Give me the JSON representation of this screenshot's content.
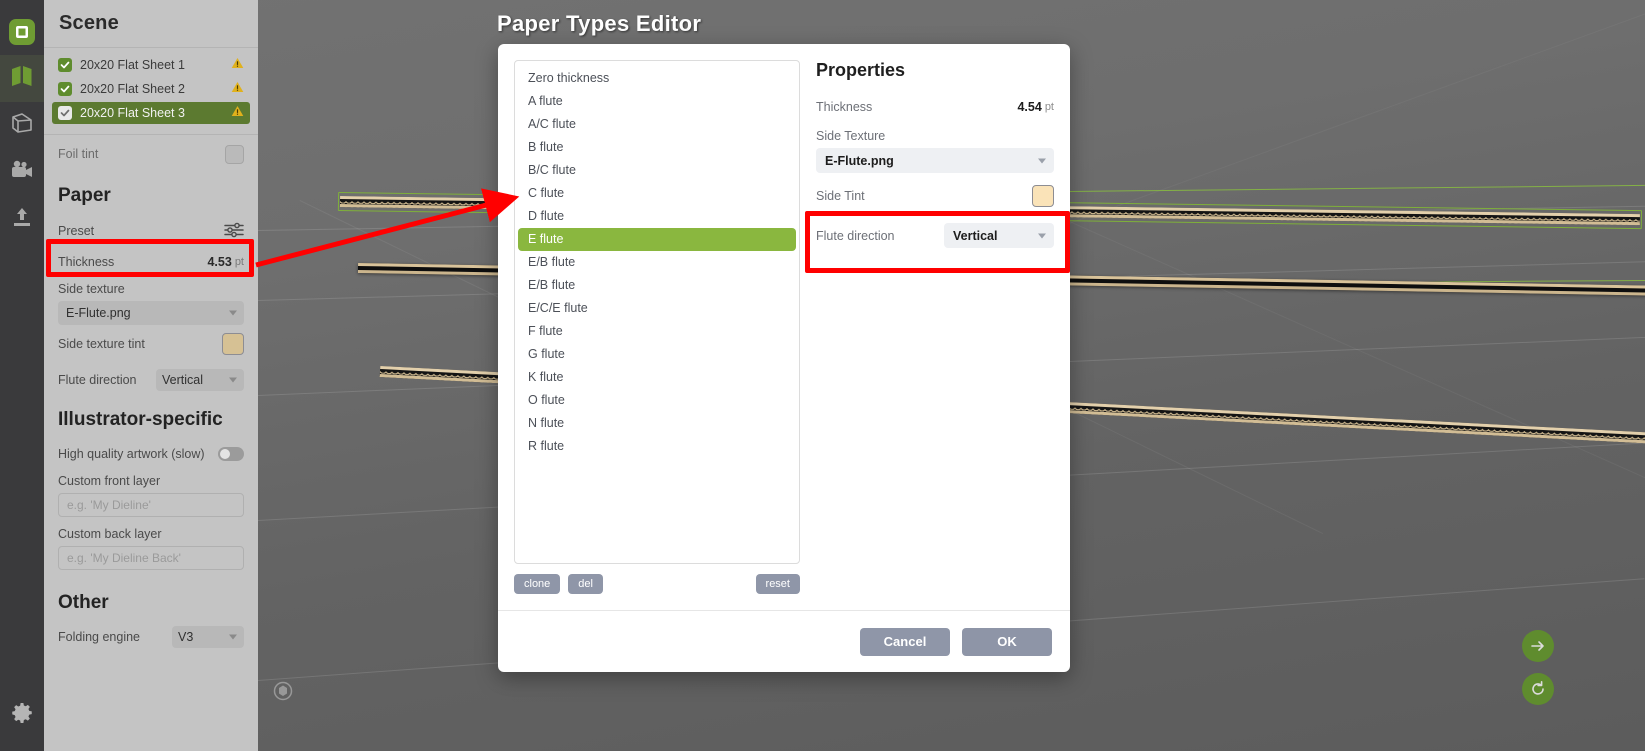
{
  "window": {
    "modal_title": "Paper Types Editor"
  },
  "rail": {
    "items": [
      {
        "name": "logo-icon",
        "label": "Logo"
      },
      {
        "name": "dieline-icon",
        "label": "Dieline"
      },
      {
        "name": "box-3d-icon",
        "label": "3D Box"
      },
      {
        "name": "camera-icon",
        "label": "Camera"
      },
      {
        "name": "export-icon",
        "label": "Export"
      }
    ],
    "gear": {
      "name": "gear-icon",
      "label": "Settings"
    }
  },
  "sidebar": {
    "title": "Scene",
    "scene_items": [
      {
        "label": "20x20 Flat Sheet 1",
        "checked": true,
        "warning": true,
        "selected": false
      },
      {
        "label": "20x20 Flat Sheet 2",
        "checked": true,
        "warning": true,
        "selected": false
      },
      {
        "label": "20x20 Flat Sheet 3",
        "checked": true,
        "warning": true,
        "selected": true
      }
    ],
    "foil_tint_label": "Foil tint",
    "paper_heading": "Paper",
    "preset_label": "Preset",
    "thickness_label": "Thickness",
    "thickness_value": "4.53",
    "thickness_unit": "pt",
    "side_texture_label": "Side texture",
    "side_texture_value": "E-Flute.png",
    "side_texture_tint_label": "Side texture tint",
    "flute_direction_label": "Flute direction",
    "flute_direction_value": "Vertical",
    "illustrator_heading": "Illustrator-specific",
    "high_quality_label": "High quality artwork (slow)",
    "custom_front_label": "Custom front layer",
    "custom_front_placeholder": "e.g. 'My Dieline'",
    "custom_back_label": "Custom back layer",
    "custom_back_placeholder": "e.g. 'My Dieline Back'",
    "other_heading": "Other",
    "folding_engine_label": "Folding engine",
    "folding_engine_value": "V3"
  },
  "modal": {
    "types": [
      "Zero thickness",
      "A flute",
      "A/C flute",
      "B flute",
      "B/C flute",
      "C flute",
      "D flute",
      "E flute",
      "E/B flute",
      "E/B flute",
      "E/C/E flute",
      "F flute",
      "G flute",
      "K flute",
      "O flute",
      "N flute",
      "R flute"
    ],
    "selected_type_index": 7,
    "list_buttons": {
      "clone": "clone",
      "del": "del",
      "reset": "reset"
    },
    "properties": {
      "title": "Properties",
      "thickness_label": "Thickness",
      "thickness_value": "4.54",
      "thickness_unit": "pt",
      "side_texture_label": "Side Texture",
      "side_texture_value": "E-Flute.png",
      "side_tint_label": "Side Tint",
      "side_tint_color": "#fae3b8",
      "flute_direction_label": "Flute direction",
      "flute_direction_value": "Vertical"
    },
    "footer": {
      "cancel": "Cancel",
      "ok": "OK"
    }
  },
  "viewport": {
    "fab_forward": "arrow-right-icon",
    "fab_refresh": "refresh-icon",
    "target": "target-icon"
  },
  "colors": {
    "accent_green": "#8ab73f",
    "select_green": "#5c7a30",
    "annotation_red": "#ff0000",
    "tint_tan": "#d6c194"
  }
}
